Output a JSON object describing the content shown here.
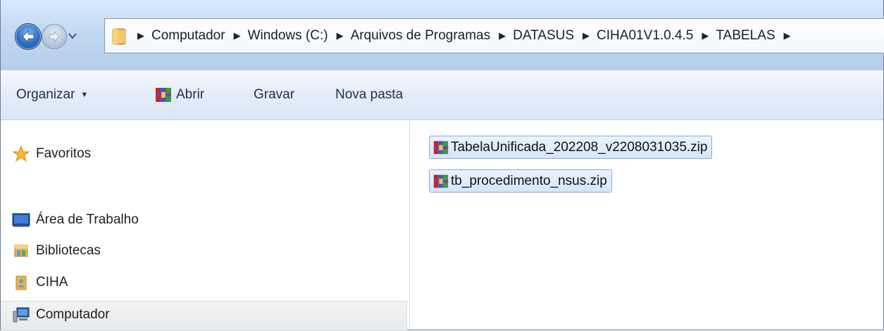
{
  "address": {
    "breadcrumbs": [
      "Computador",
      "Windows (C:)",
      "Arquivos de Programas",
      "DATASUS",
      "CIHA01V1.0.4.5",
      "TABELAS"
    ],
    "separator": "▶"
  },
  "toolbar": {
    "organize_label": "Organizar",
    "open_label": "Abrir",
    "burn_label": "Gravar",
    "new_folder_label": "Nova pasta"
  },
  "navigation": {
    "items": [
      {
        "label": "Favoritos",
        "icon": "star-icon"
      },
      {
        "label": "Área de Trabalho",
        "icon": "desktop-icon"
      },
      {
        "label": "Bibliotecas",
        "icon": "libraries-icon"
      },
      {
        "label": "CIHA",
        "icon": "user-folder-icon"
      },
      {
        "label": "Computador",
        "icon": "computer-icon"
      }
    ],
    "selected": "Computador"
  },
  "files": [
    {
      "name": "TabelaUnificada_202208_v2208031035.zip",
      "icon": "winrar-archive-icon"
    },
    {
      "name": "tb_procedimento_nsus.zip",
      "icon": "winrar-archive-icon"
    }
  ],
  "colors": {
    "address_bar": "#c3d9f2",
    "toolbar": "#e3edf8",
    "selection": "#d5e6f9",
    "selection_border": "#86a9d6",
    "back_button": "#2c6dc6"
  }
}
